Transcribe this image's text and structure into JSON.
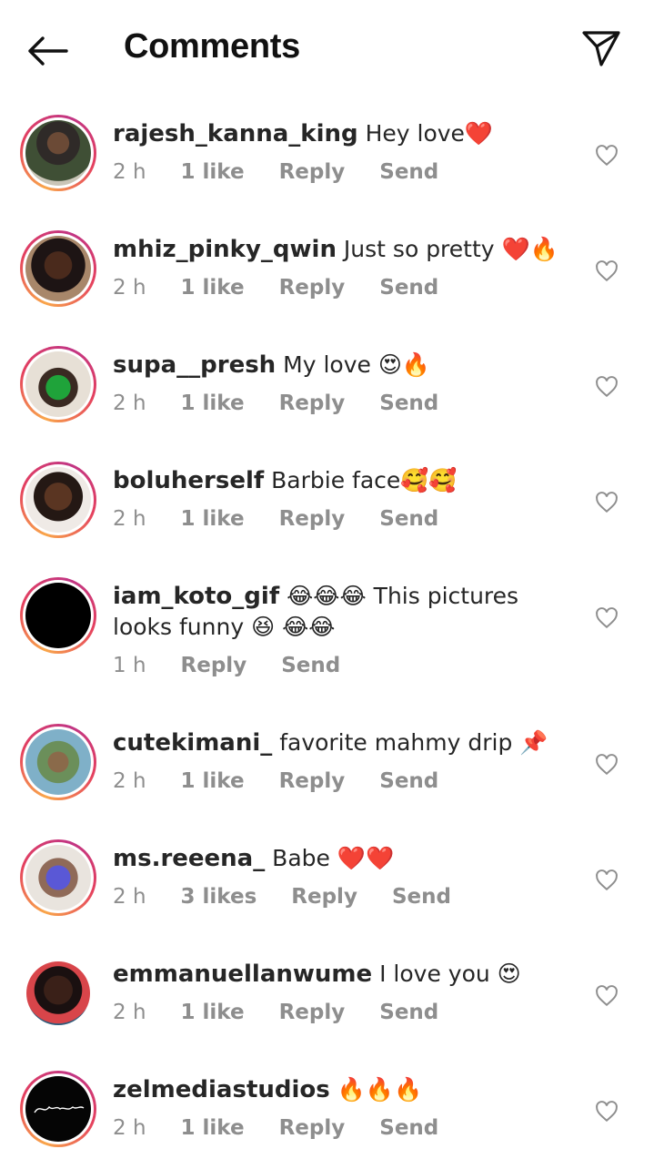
{
  "header": {
    "title": "Comments",
    "back_icon": "arrow-left-icon",
    "send_icon": "paper-plane-icon"
  },
  "actions": {
    "reply": "Reply",
    "send": "Send"
  },
  "colors": {
    "text": "#262626",
    "meta": "#8e8e8e",
    "ring_start": "#f9a64a",
    "ring_end": "#c13584"
  },
  "comments": [
    {
      "username": "rajesh_kanna_king",
      "text": " Hey love❤️",
      "time": "2 h",
      "likes": "1 like"
    },
    {
      "username": "mhiz_pinky_qwin",
      "text": " Just so pretty ❤️🔥",
      "time": "2 h",
      "likes": "1 like"
    },
    {
      "username": "supa__presh",
      "text": " My love 😍🔥",
      "time": "2 h",
      "likes": "1 like"
    },
    {
      "username": "boluherself",
      "text": " Barbie face🥰🥰",
      "time": "2 h",
      "likes": "1 like"
    },
    {
      "username": "iam_koto_gif",
      "text": " 😂😂😂 This pictures looks funny 😆 😂😂",
      "time": "1 h",
      "likes": ""
    },
    {
      "username": "cutekimani_",
      "text": " favorite mahmy drip 📌",
      "time": "2 h",
      "likes": "1 like"
    },
    {
      "username": "ms.reeena_",
      "text": " Babe ❤️❤️",
      "time": "2 h",
      "likes": "3 likes"
    },
    {
      "username": "emmanuellanwume",
      "text": " I love you 😍",
      "time": "2 h",
      "likes": "1 like"
    },
    {
      "username": "zelmediastudios",
      "text": " 🔥🔥🔥",
      "time": "2 h",
      "likes": "1 like"
    }
  ]
}
